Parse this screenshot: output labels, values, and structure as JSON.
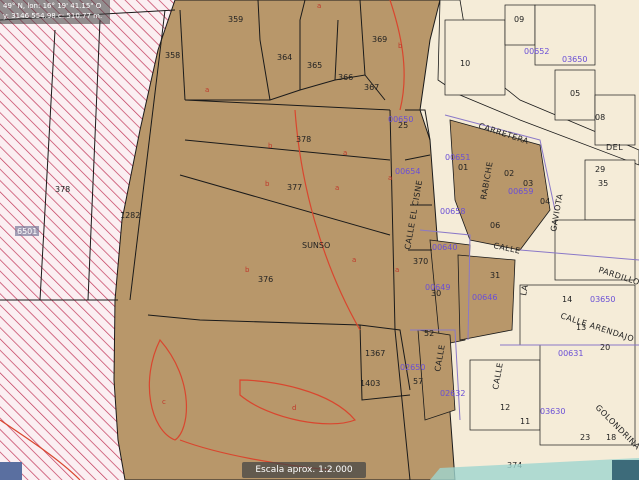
{
  "coords": {
    "line1": "49° N, lon: 16° 19' 41.15\" O",
    "line2": "y: 3146 554.98  c: 510.77 m."
  },
  "scale_label": "Escala aprox. 1:2.000",
  "parcels": {
    "p359": "359",
    "p358": "358",
    "p364": "364",
    "p365": "365",
    "p366": "366",
    "p367": "367",
    "p369": "369",
    "p378": "378",
    "p377": "377",
    "p376": "376",
    "p1282": "1282",
    "p370": "370",
    "p1367": "1367",
    "p1403": "1403",
    "p374": "374",
    "p378w": "378",
    "p57": "57",
    "p52": "52",
    "p25": "25",
    "p10": "10",
    "p09": "09",
    "p05": "05",
    "p08": "08",
    "p29": "29",
    "p35": "35",
    "p01": "01",
    "p02": "02",
    "p03": "03",
    "p04": "04",
    "p06": "06",
    "p30": "30",
    "p31": "31",
    "p14": "14",
    "p13": "13",
    "p12": "12",
    "p11": "11",
    "p20": "20",
    "p23": "23",
    "p18": "18"
  },
  "sublabels": {
    "a": "a",
    "b": "b",
    "c": "c",
    "d": "d"
  },
  "blocks": {
    "b1": "00650",
    "b2": "00651",
    "b3": "03650",
    "b4": "00652",
    "b5": "00646",
    "b6": "02632",
    "b7": "03630",
    "b8": "00631",
    "b9": "00640",
    "b10": "02650",
    "b11": "00649",
    "b12": "00654",
    "b13": "00658",
    "b14": "00659",
    "b15": "03650"
  },
  "zone_label": "SUNSO",
  "zone_code": "6501",
  "streets": {
    "carretera": "CARRETERA",
    "del": "DEL",
    "rabiche": "RABICHE",
    "calle1": "CALLE",
    "calle2": "CALLE",
    "calle3": "CALLE",
    "calle_elcisne": "CALLE EL CISNE",
    "calle_arenda": "CALLE ARENDAJO",
    "gaviota": "GAVIOTA",
    "pardillo": "PARDILLO",
    "golondrina": "GOLONDRINA",
    "la": "LA"
  },
  "colors": {
    "parcel_fill": "#b8976a",
    "road": "#f5ecd8",
    "hatch": "#c2385a",
    "outline": "#1a1a1a",
    "red_line": "#d9462e",
    "blue_text": "#6a4fd6",
    "blue_line": "#8a78c8"
  }
}
